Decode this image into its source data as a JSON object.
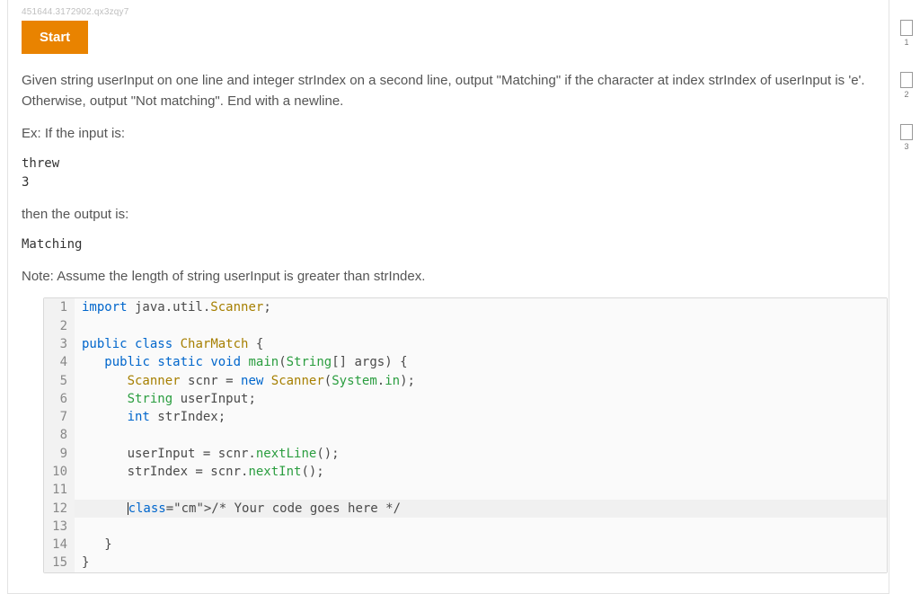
{
  "meta": {
    "id": "451644.3172902.qx3zqy7"
  },
  "start": {
    "label": "Start"
  },
  "problem": {
    "desc": "Given string userInput on one line and integer strIndex on a second line, output \"Matching\" if the character at index strIndex of userInput is 'e'. Otherwise, output \"Not matching\". End with a newline.",
    "ex_label": "Ex: If the input is:",
    "ex_input": "threw\n3",
    "then": "then the output is:",
    "ex_output": "Matching",
    "note": "Note: Assume the length of string userInput is greater than strIndex."
  },
  "code": {
    "lines": [
      "import java.util.Scanner;",
      "",
      "public class CharMatch {",
      "   public static void main(String[] args) {",
      "      Scanner scnr = new Scanner(System.in);",
      "      String userInput;",
      "      int strIndex;",
      "",
      "      userInput = scnr.nextLine();",
      "      strIndex = scnr.nextInt();",
      "",
      "      /* Your code goes here */",
      "",
      "   }",
      "}"
    ],
    "highlight": 12
  },
  "steps": {
    "items": [
      "1",
      "2",
      "3"
    ]
  }
}
